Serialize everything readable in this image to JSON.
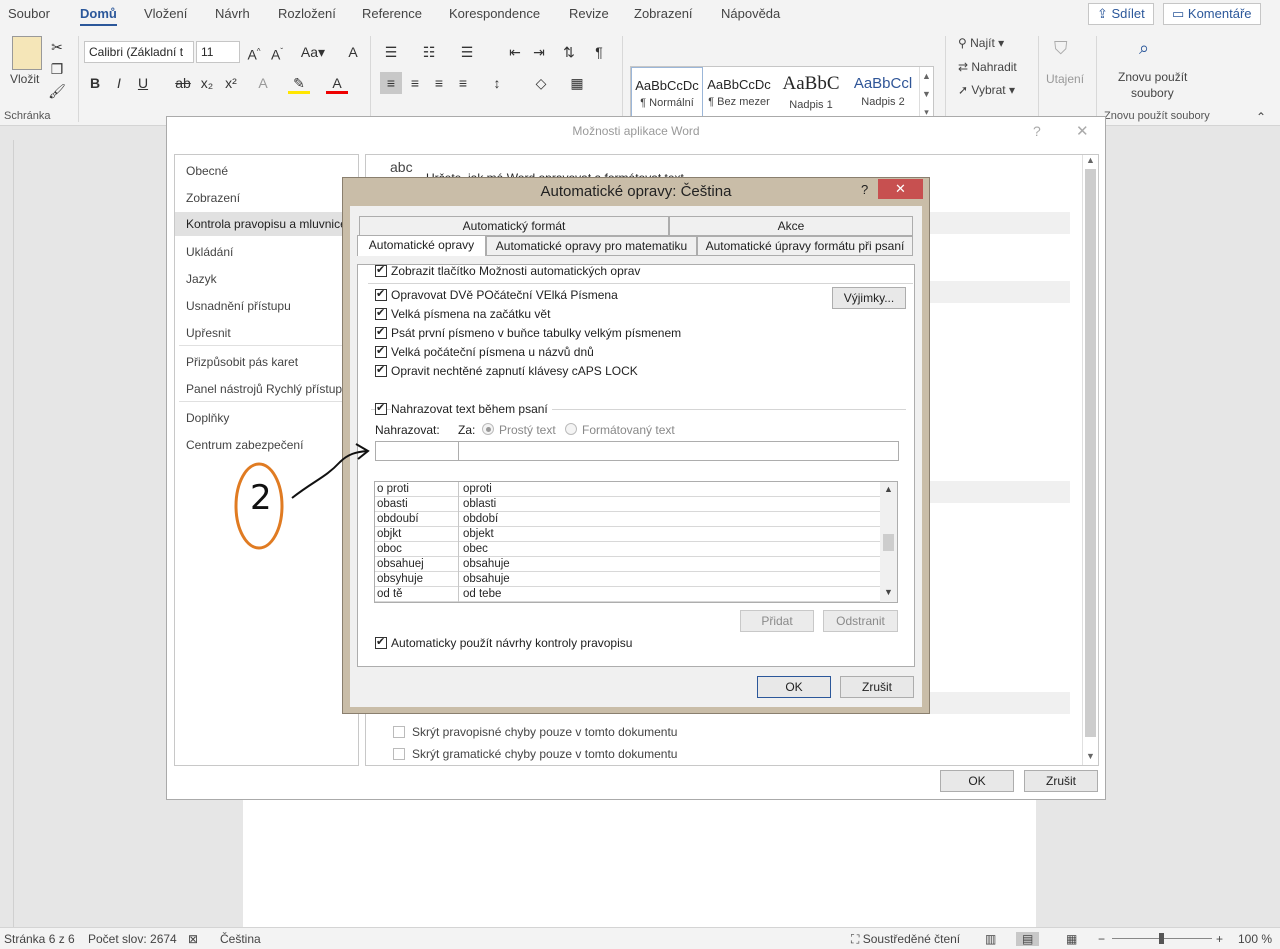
{
  "ribbon": {
    "tabs": [
      "Soubor",
      "Domů",
      "Vložení",
      "Návrh",
      "Rozložení",
      "Reference",
      "Korespondence",
      "Revize",
      "Zobrazení",
      "Nápověda"
    ],
    "active_tab": "Domů",
    "share_label": "Sdílet",
    "comments_label": "Komentáře",
    "paste_label": "Vložit",
    "clipboard_group": "Schránka",
    "font_name": "Calibri (Základní t",
    "font_size": "11",
    "styles": [
      {
        "preview": "AaBbCcDc",
        "name": "¶ Normální"
      },
      {
        "preview": "AaBbCcDc",
        "name": "¶ Bez mezer"
      },
      {
        "preview": "AaBbC",
        "name": "Nadpis 1"
      },
      {
        "preview": "AaBbCcl",
        "name": "Nadpis 2"
      }
    ],
    "find_label": "Najít",
    "replace_label": "Nahradit",
    "select_label": "Vybrat",
    "sensitivity_label": "Utajení",
    "reuse_label_1": "Znovu použít",
    "reuse_label_2": "soubory",
    "reuse_group": "Znovu použít soubory"
  },
  "status": {
    "page": "Stránka 6 z 6",
    "words": "Počet slov: 2674",
    "language": "Čeština",
    "focus": "Soustředěné čtení",
    "zoom": "100 %"
  },
  "options_dialog": {
    "title": "Možnosti aplikace Word",
    "nav_items": [
      "Obecné",
      "Zobrazení",
      "Kontrola pravopisu a mluvnice",
      "Ukládání",
      "Jazyk",
      "Usnadnění přístupu",
      "Upřesnit",
      "Přizpůsobit pás karet",
      "Panel nástrojů Rychlý přístup",
      "Doplňky",
      "Centrum zabezpečení"
    ],
    "abc_icon_text": "abc",
    "header_text": "Určete, jak má Word opravovat a formátovat text.",
    "hide_spelling": "Skrýt pravopisné chyby pouze v tomto dokumentu",
    "hide_grammar": "Skrýt gramatické chyby pouze v tomto dokumentu",
    "ok": "OK",
    "cancel": "Zrušit"
  },
  "autocorrect_dialog": {
    "title": "Automatické opravy: Čeština",
    "help": "?",
    "close": "✕",
    "tabs_row1": [
      "Automatický formát",
      "Akce"
    ],
    "tabs_row2": [
      "Automatické opravy",
      "Automatické opravy pro matematiku",
      "Automatické úpravy formátu při psaní"
    ],
    "show_buttons": "Zobrazit tlačítko Možnosti automatických oprav",
    "options": [
      "Opravovat DVě POčáteční VElká Písmena",
      "Velká písmena na začátku vět",
      "Psát první písmeno v buňce tabulky velkým písmenem",
      "Velká počáteční písmena u názvů dnů",
      "Opravit nechtěné zapnutí klávesy cAPS LOCK"
    ],
    "exceptions": "Výjimky...",
    "replace_as_you_type": "Nahrazovat text během psaní",
    "replace_label": "Nahrazovat:",
    "with_label": "Za:",
    "plain_text": "Prostý text",
    "formatted_text": "Formátovaný text",
    "rows": [
      [
        "o proti",
        "oproti"
      ],
      [
        "obasti",
        "oblasti"
      ],
      [
        "obdoubí",
        "období"
      ],
      [
        "objkt",
        "objekt"
      ],
      [
        "oboc",
        "obec"
      ],
      [
        "obsahuej",
        "obsahuje"
      ],
      [
        "obsyhuje",
        "obsahuje"
      ],
      [
        "od tě",
        "od tebe"
      ]
    ],
    "add": "Přidat",
    "delete": "Odstranit",
    "use_suggestions": "Automaticky použít návrhy kontroly pravopisu",
    "ok": "OK",
    "cancel": "Zrušit"
  },
  "annotation": {
    "text": "2",
    "color": "#e07b22"
  }
}
